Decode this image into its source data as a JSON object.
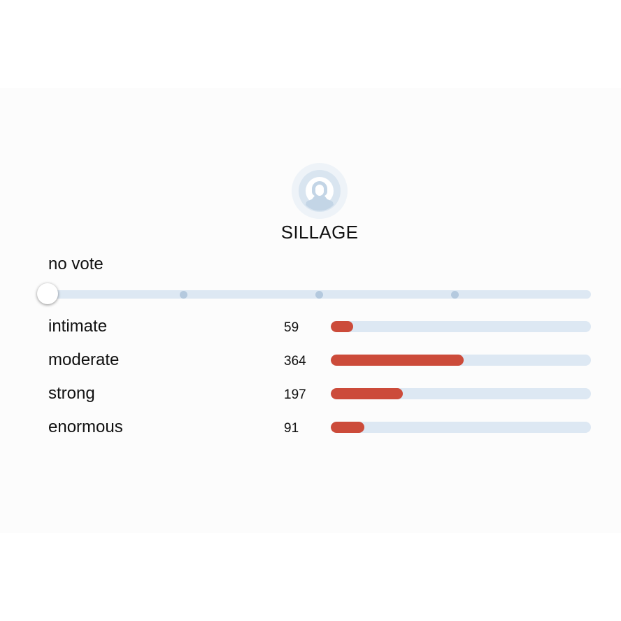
{
  "section": {
    "title": "SILLAGE",
    "avatar_icon": "user-placeholder-icon"
  },
  "vote": {
    "current_label": "no vote",
    "slider_positions": 5,
    "slider_value": 0
  },
  "colors": {
    "bar_fill": "#cc4b3a",
    "bar_track": "#dde8f3",
    "slider_dot": "#b4c9de"
  },
  "options": [
    {
      "label": "intimate",
      "count": "59",
      "fill_fraction": 0.085
    },
    {
      "label": "moderate",
      "count": "364",
      "fill_fraction": 0.51
    },
    {
      "label": "strong",
      "count": "197",
      "fill_fraction": 0.277
    },
    {
      "label": "enormous",
      "count": "91",
      "fill_fraction": 0.13
    }
  ]
}
